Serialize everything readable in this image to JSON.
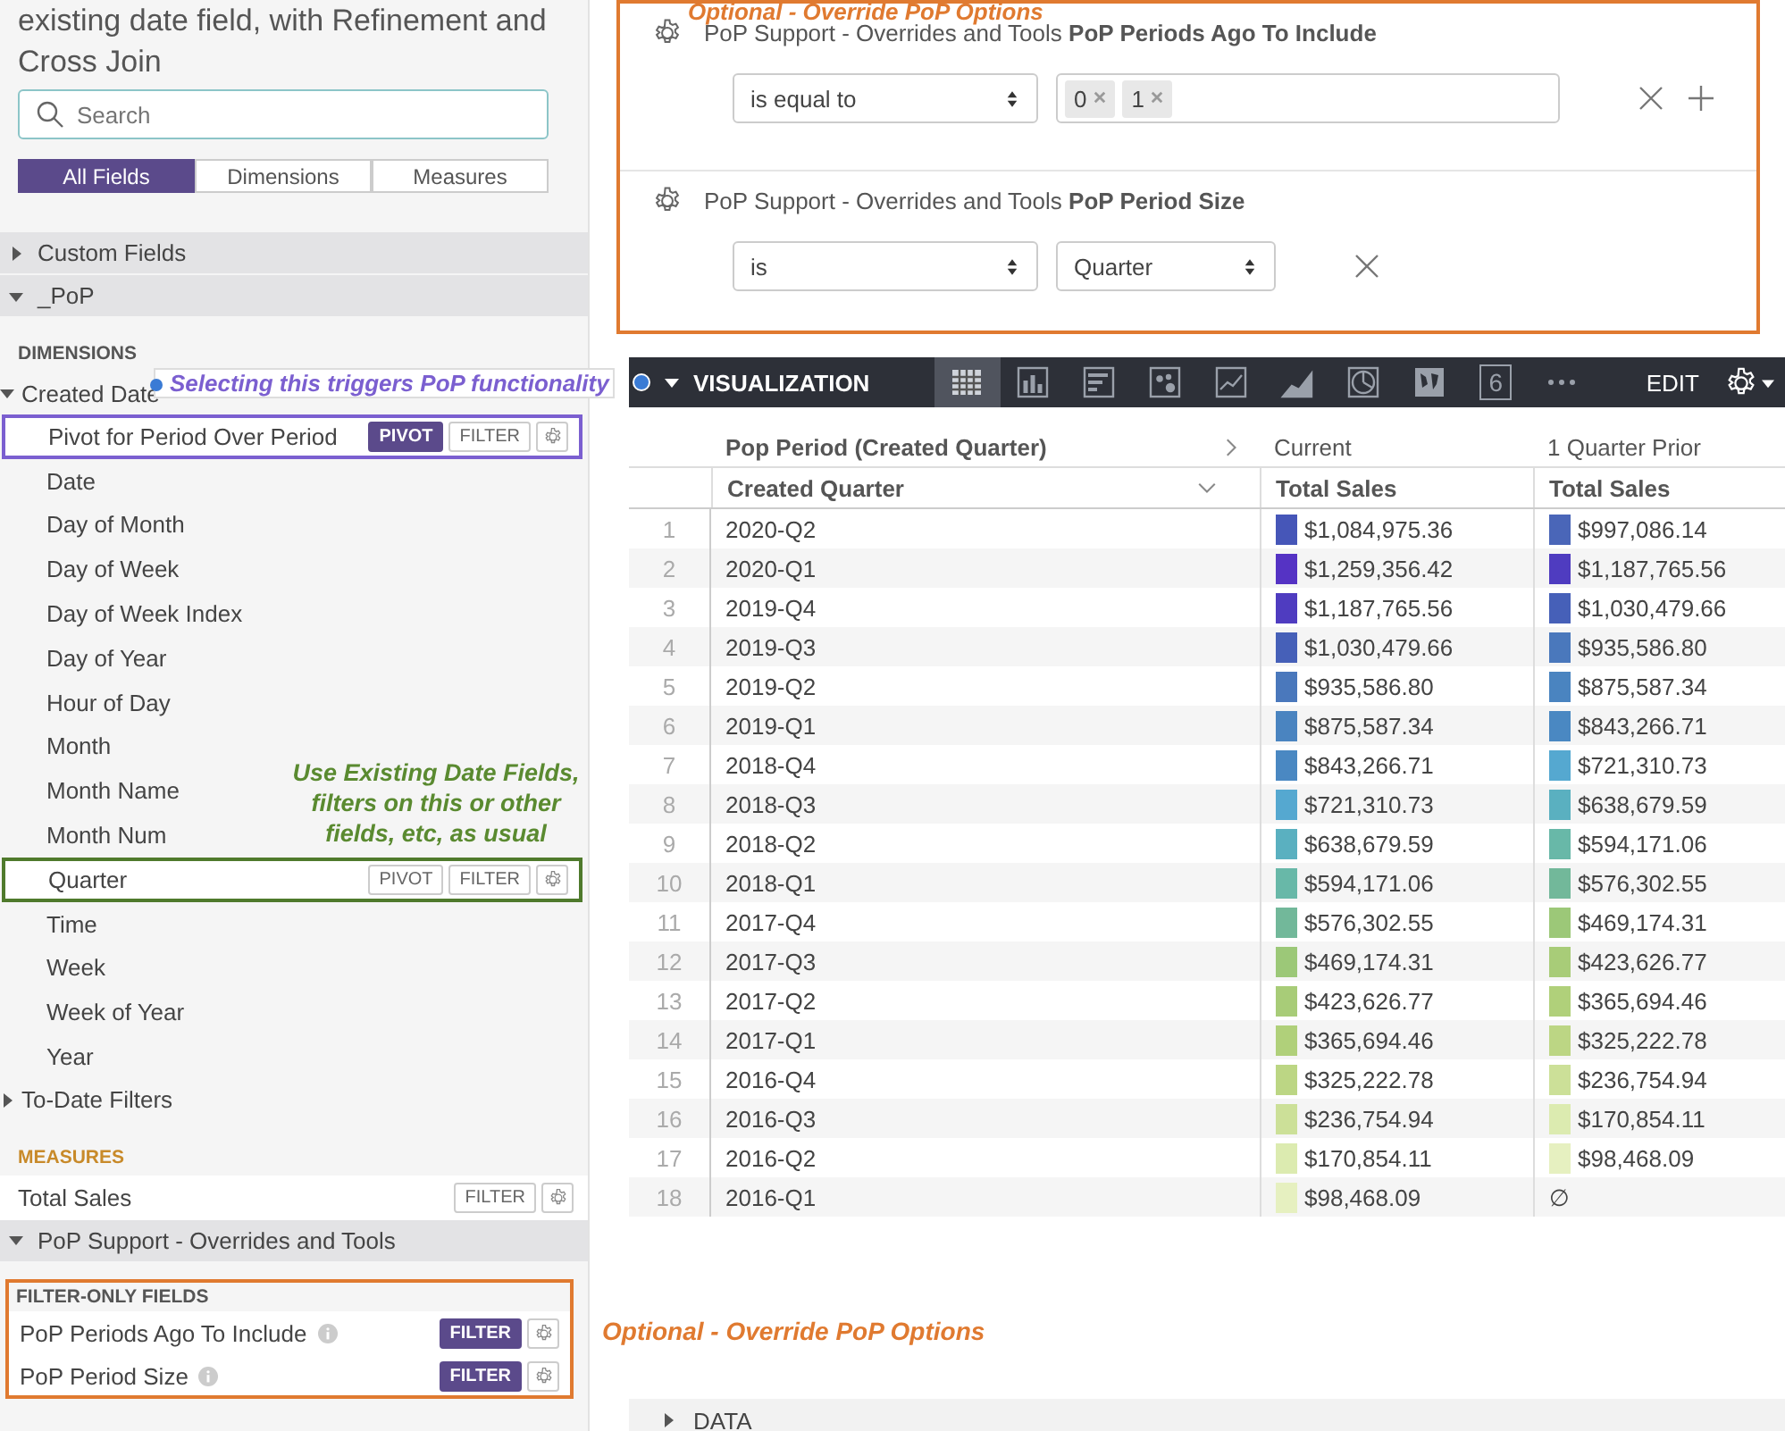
{
  "sidebar": {
    "title": "existing date field, with Refinement and Cross Join",
    "search": {
      "placeholder": "Search"
    },
    "field_tabs": [
      {
        "label": "All Fields",
        "selected": true
      },
      {
        "label": "Dimensions",
        "selected": false
      },
      {
        "label": "Measures",
        "selected": false
      }
    ],
    "views": [
      {
        "label": "Custom Fields",
        "expanded": false
      },
      {
        "label": "_PoP",
        "expanded": true,
        "sections": [
          {
            "kind": "dimensions",
            "title": "DIMENSIONS",
            "items": [
              {
                "label": "Created Date",
                "expanded": true,
                "children": [
                  {
                    "label": "Pivot for Period Over Period",
                    "color": "#7b5fd0",
                    "actions": [
                      {
                        "label": "PIVOT",
                        "selected": true
                      },
                      {
                        "label": "FILTER",
                        "selected": false
                      }
                    ]
                  },
                  {
                    "label": "Date"
                  },
                  {
                    "label": "Day of Month"
                  },
                  {
                    "label": "Day of Week"
                  },
                  {
                    "label": "Day of Week Index"
                  },
                  {
                    "label": "Day of Year"
                  },
                  {
                    "label": "Hour of Day"
                  },
                  {
                    "label": "Month"
                  },
                  {
                    "label": "Month Name"
                  },
                  {
                    "label": "Month Num"
                  },
                  {
                    "label": "Quarter",
                    "color": "#4f7a2c",
                    "actions": [
                      {
                        "label": "PIVOT",
                        "selected": false
                      },
                      {
                        "label": "FILTER",
                        "selected": false
                      }
                    ]
                  },
                  {
                    "label": "Time"
                  },
                  {
                    "label": "Week"
                  },
                  {
                    "label": "Week of Year"
                  },
                  {
                    "label": "Year"
                  }
                ]
              },
              {
                "label": "To-Date Filters",
                "expanded": false
              }
            ]
          },
          {
            "kind": "measures",
            "title": "MEASURES",
            "items": [
              {
                "label": "Total Sales",
                "actions": [
                  {
                    "label": "FILTER",
                    "selected": false
                  }
                ]
              }
            ]
          }
        ]
      },
      {
        "label": "PoP Support - Overrides and Tools",
        "expanded": true,
        "sections": [
          {
            "kind": "filter_only",
            "title": "FILTER-ONLY FIELDS",
            "color": "#e07a30",
            "items": [
              {
                "label": "PoP Periods Ago To Include",
                "info": true,
                "actions": [
                  {
                    "label": "FILTER",
                    "selected": true
                  }
                ]
              },
              {
                "label": "PoP Period Size",
                "info": true,
                "actions": [
                  {
                    "label": "FILTER",
                    "selected": true
                  }
                ]
              }
            ]
          }
        ]
      }
    ]
  },
  "filters": [
    {
      "title": "PoP Support - Overrides and Tools **PoP Periods Ago To Include**",
      "operator": "is equal to",
      "kind": "tokens",
      "tokens": [
        "0",
        "1"
      ],
      "removable": true,
      "addable": true
    },
    {
      "title": "PoP Support - Overrides and Tools **PoP Period Size**",
      "operator": "is",
      "kind": "select",
      "value": "Quarter",
      "removable": true,
      "addable": false
    }
  ],
  "visualization": {
    "label": "VISUALIZATION",
    "expanded": true,
    "types": [
      {
        "kind": "table",
        "selected": true
      },
      {
        "kind": "column",
        "selected": false
      },
      {
        "kind": "bar",
        "selected": false
      },
      {
        "kind": "scatter",
        "selected": false
      },
      {
        "kind": "line",
        "selected": false
      },
      {
        "kind": "area",
        "selected": false
      },
      {
        "kind": "pie",
        "selected": false
      },
      {
        "kind": "map",
        "selected": false
      },
      {
        "kind": "single_value",
        "label": "6",
        "selected": false
      },
      {
        "kind": "more",
        "selected": false
      }
    ],
    "edit": "EDIT"
  },
  "table": {
    "pivot_header": {
      "label": "Pop Period (Created Quarter)",
      "values": [
        "Current",
        "1 Quarter Prior"
      ]
    },
    "columns": [
      {
        "label": "Created Quarter",
        "sorted": true
      },
      {
        "label": "Total Sales",
        "sorted": false
      },
      {
        "label": "Total Sales",
        "sorted": false
      }
    ],
    "rows": [
      {
        "index": "1",
        "quarter": "2020-Q2",
        "current": {
          "value": "$1,084,975.36",
          "color": "#4656b8"
        },
        "prior": {
          "value": "$997,086.14",
          "color": "#4a66b8"
        }
      },
      {
        "index": "2",
        "quarter": "2020-Q1",
        "current": {
          "value": "$1,259,356.42",
          "color": "#5533c4"
        },
        "prior": {
          "value": "$1,187,765.56",
          "color": "#4f3cc0"
        }
      },
      {
        "index": "3",
        "quarter": "2019-Q4",
        "current": {
          "value": "$1,187,765.56",
          "color": "#4f3cc0"
        },
        "prior": {
          "value": "$1,030,479.66",
          "color": "#4660b8"
        }
      },
      {
        "index": "4",
        "quarter": "2019-Q3",
        "current": {
          "value": "$1,030,479.66",
          "color": "#4660b8"
        },
        "prior": {
          "value": "$935,586.80",
          "color": "#4a78bc"
        }
      },
      {
        "index": "5",
        "quarter": "2019-Q2",
        "current": {
          "value": "$935,586.80",
          "color": "#4a78bc"
        },
        "prior": {
          "value": "$875,587.34",
          "color": "#4a84c0"
        }
      },
      {
        "index": "6",
        "quarter": "2019-Q1",
        "current": {
          "value": "$875,587.34",
          "color": "#4a84c0"
        },
        "prior": {
          "value": "$843,266.71",
          "color": "#4a88c2"
        }
      },
      {
        "index": "7",
        "quarter": "2018-Q4",
        "current": {
          "value": "$843,266.71",
          "color": "#4a88c2"
        },
        "prior": {
          "value": "$721,310.73",
          "color": "#55a8d0"
        }
      },
      {
        "index": "8",
        "quarter": "2018-Q3",
        "current": {
          "value": "$721,310.73",
          "color": "#55a8d0"
        },
        "prior": {
          "value": "$638,679.59",
          "color": "#5ab0c0"
        }
      },
      {
        "index": "9",
        "quarter": "2018-Q2",
        "current": {
          "value": "$638,679.59",
          "color": "#5ab0c0"
        },
        "prior": {
          "value": "$594,171.06",
          "color": "#68b8a8"
        }
      },
      {
        "index": "10",
        "quarter": "2018-Q1",
        "current": {
          "value": "$594,171.06",
          "color": "#68b8a8"
        },
        "prior": {
          "value": "$576,302.55",
          "color": "#72b89a"
        }
      },
      {
        "index": "11",
        "quarter": "2017-Q4",
        "current": {
          "value": "$576,302.55",
          "color": "#72b89a"
        },
        "prior": {
          "value": "$469,174.31",
          "color": "#9cc878"
        }
      },
      {
        "index": "12",
        "quarter": "2017-Q3",
        "current": {
          "value": "$469,174.31",
          "color": "#9cc878"
        },
        "prior": {
          "value": "$423,626.77",
          "color": "#a8cc78"
        }
      },
      {
        "index": "13",
        "quarter": "2017-Q2",
        "current": {
          "value": "$423,626.77",
          "color": "#a8cc78"
        },
        "prior": {
          "value": "$365,694.46",
          "color": "#b0d07a"
        }
      },
      {
        "index": "14",
        "quarter": "2017-Q1",
        "current": {
          "value": "$365,694.46",
          "color": "#b0d07a"
        },
        "prior": {
          "value": "$325,222.78",
          "color": "#bcd684"
        }
      },
      {
        "index": "15",
        "quarter": "2016-Q4",
        "current": {
          "value": "$325,222.78",
          "color": "#bcd684"
        },
        "prior": {
          "value": "$236,754.94",
          "color": "#cce098"
        }
      },
      {
        "index": "16",
        "quarter": "2016-Q3",
        "current": {
          "value": "$236,754.94",
          "color": "#cce098"
        },
        "prior": {
          "value": "$170,854.11",
          "color": "#dcebb0"
        }
      },
      {
        "index": "17",
        "quarter": "2016-Q2",
        "current": {
          "value": "$170,854.11",
          "color": "#dcebb0"
        },
        "prior": {
          "value": "$98,468.09",
          "color": "#e6f0c0"
        }
      },
      {
        "index": "18",
        "quarter": "2016-Q1",
        "current": {
          "value": "$98,468.09",
          "color": "#e6f0c0"
        },
        "prior": {
          "value": "∅"
        }
      }
    ]
  },
  "data_section": {
    "label": "DATA",
    "expanded": false
  },
  "notes": {
    "filters": {
      "text": "Optional - Override PoP Options",
      "color": "#e07a30"
    },
    "pivot": {
      "text": "Selecting this triggers PoP functionality",
      "color": "#7b5fd0"
    },
    "quarter": {
      "text": "Use Existing Date Fields, filters on this or other fields, etc, as usual",
      "color": "#5a8a30"
    },
    "bottom": {
      "text": "Optional - Override PoP Options",
      "color": "#e07a30"
    }
  }
}
